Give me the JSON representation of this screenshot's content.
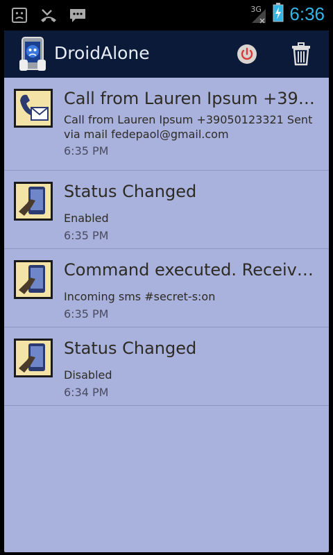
{
  "status_bar": {
    "left_icons": [
      "android-debug-icon",
      "missed-call-icon",
      "sms-icon"
    ],
    "network_label": "3G",
    "time": "6:36",
    "accent": "#33b5e5"
  },
  "action_bar": {
    "title": "DroidAlone",
    "background": "#0c1a3a"
  },
  "list": {
    "background": "#a8b2dc",
    "items": [
      {
        "icon": "call-mail-icon",
        "title": "Call from Lauren Ipsum +3905…",
        "body_line1": "Call from Lauren Ipsum +39050123321  Sent",
        "body_line2": "via mail fedepaol@gmail.com",
        "time": "6:35 PM"
      },
      {
        "icon": "phone-hand-icon",
        "title": "Status Changed",
        "body_line1": "Enabled",
        "body_line2": "",
        "time": "6:35 PM"
      },
      {
        "icon": "phone-hand-icon",
        "title": "Command executed. Receive…",
        "body_line1": "Incoming sms #secret-s:on",
        "body_line2": "",
        "time": "6:35 PM"
      },
      {
        "icon": "phone-hand-icon",
        "title": "Status Changed",
        "body_line1": "Disabled",
        "body_line2": "",
        "time": "6:34 PM"
      }
    ]
  }
}
